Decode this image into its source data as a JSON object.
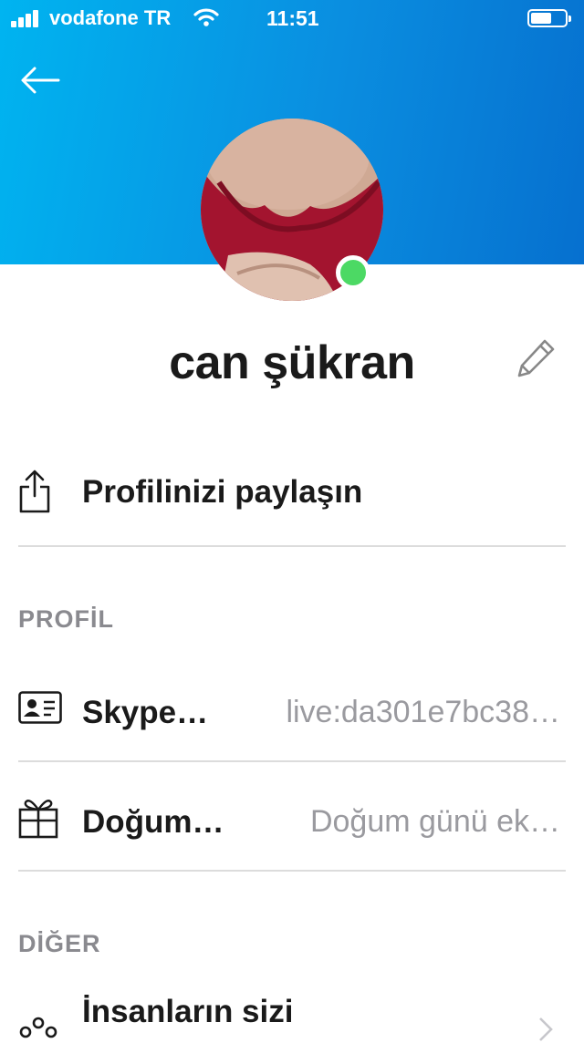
{
  "status_bar": {
    "carrier": "vodafone TR",
    "time": "11:51",
    "battery_level": 0.6
  },
  "header": {
    "gradient_start": "#00b4f0",
    "gradient_end": "#0670cf",
    "back_icon": "arrow-left-icon"
  },
  "profile": {
    "name": "can şükran",
    "presence": "online",
    "presence_color": "#4cd964",
    "edit_icon": "pencil-icon"
  },
  "share": {
    "label": "Profilinizi paylaşın",
    "icon": "share-icon"
  },
  "sections": {
    "profile_title": "PROFİL",
    "other_title": "DİĞER"
  },
  "fields": [
    {
      "label": "Skype…",
      "value": "live:da301e7bc38…",
      "icon": "id-card-icon"
    },
    {
      "label": "Doğum…",
      "value": "Doğum günü ek…",
      "icon": "gift-icon"
    }
  ],
  "other": {
    "people_label": "İnsanların sizi",
    "icon": "people-icon"
  }
}
